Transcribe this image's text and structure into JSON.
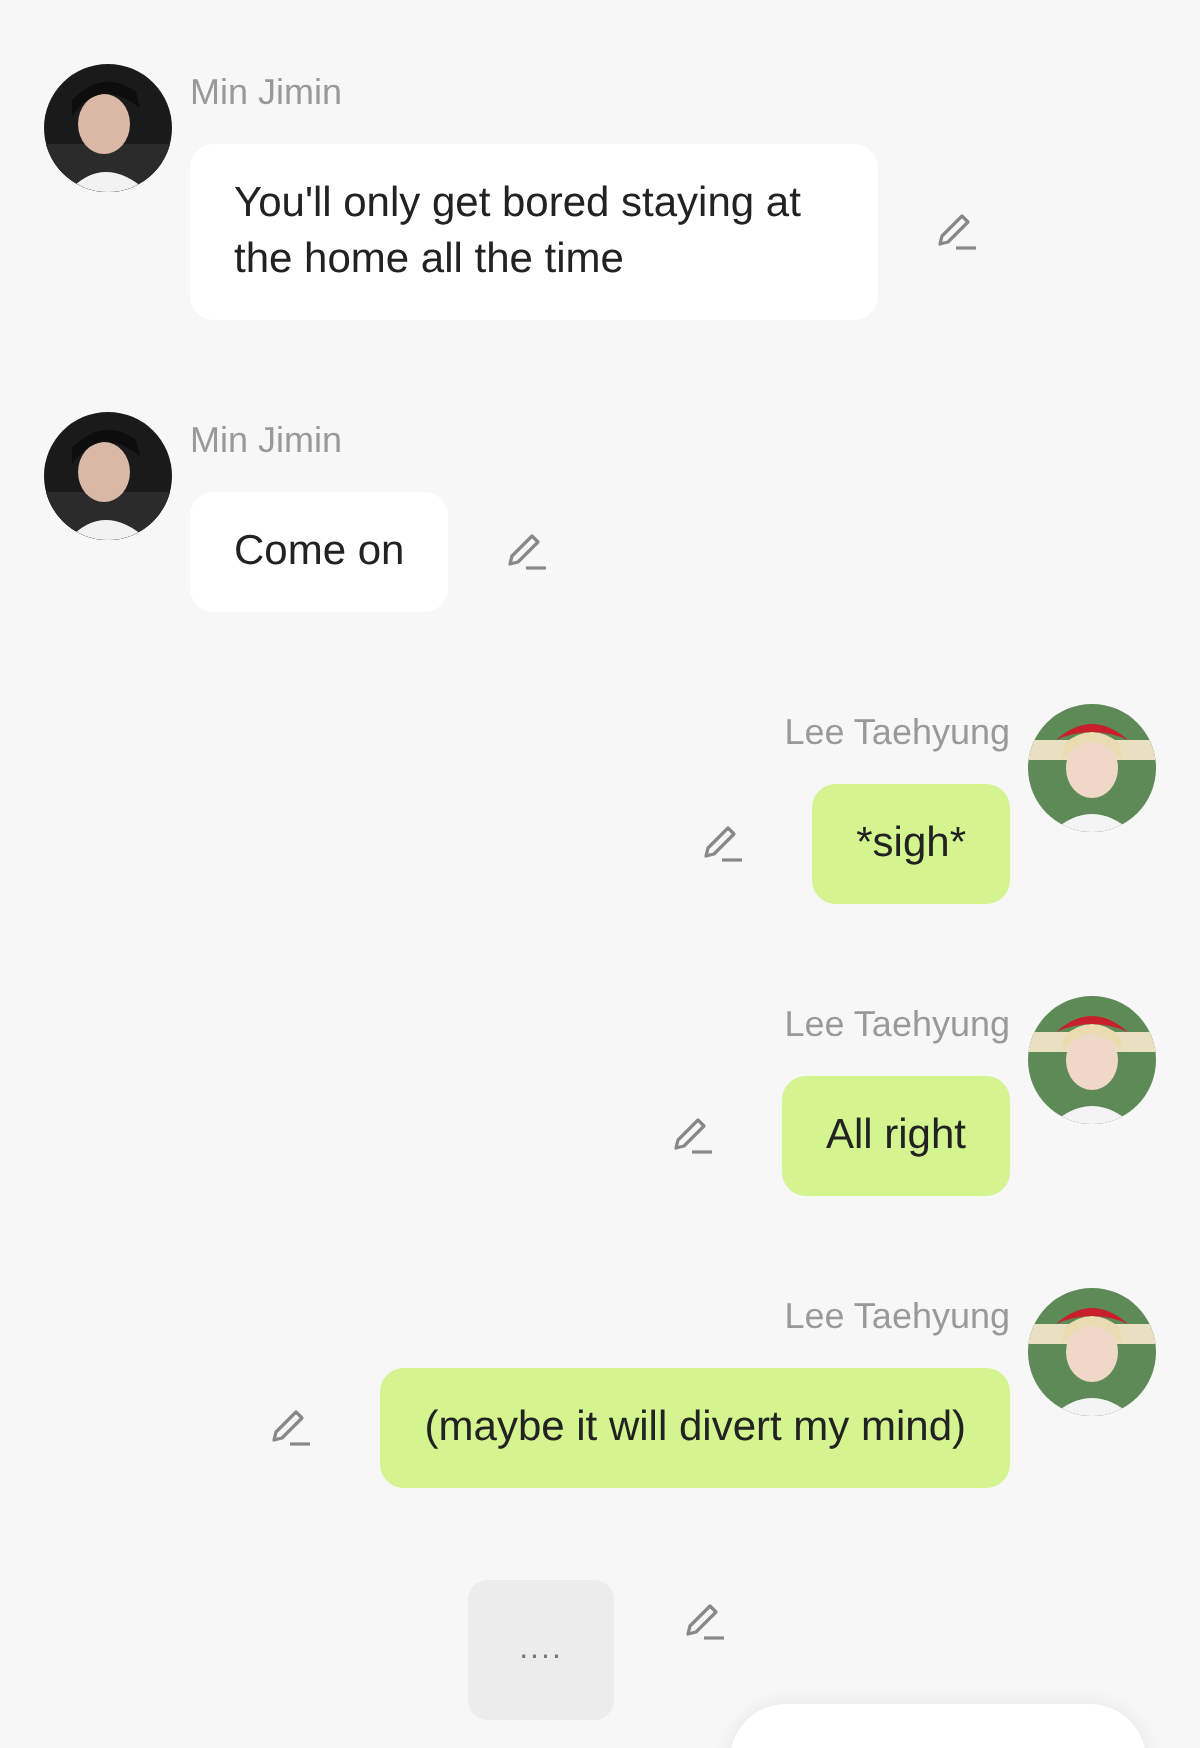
{
  "messages": [
    {
      "outgoing": false,
      "kind": "text",
      "sender": "Min Jimin",
      "text": "You'll only get bored staying at the home all the time"
    },
    {
      "outgoing": false,
      "kind": "text",
      "sender": "Min Jimin",
      "text": "Come on"
    },
    {
      "outgoing": true,
      "kind": "text",
      "sender": "Lee Taehyung",
      "text": "*sigh*"
    },
    {
      "outgoing": true,
      "kind": "text",
      "sender": "Lee Taehyung",
      "text": "All right"
    },
    {
      "outgoing": true,
      "kind": "text",
      "sender": "Lee Taehyung",
      "text": "(maybe it will divert my mind)"
    },
    {
      "kind": "typing",
      "text": "...."
    }
  ]
}
